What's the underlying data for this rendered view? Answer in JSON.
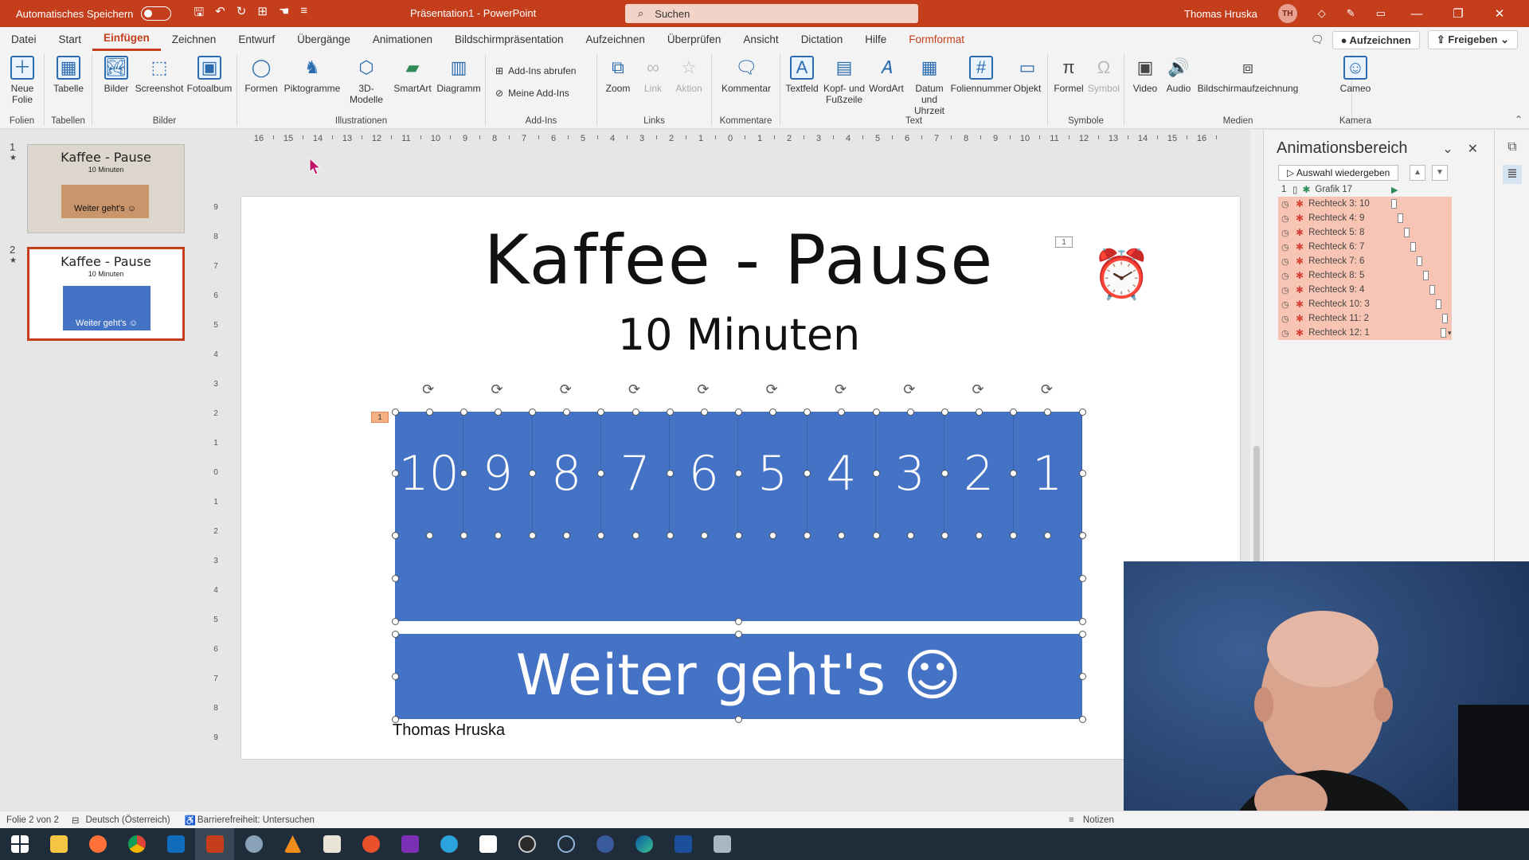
{
  "titlebar": {
    "autosave_label": "Automatisches Speichern",
    "doc_title": "Präsentation1 - PowerPoint",
    "search_placeholder": "Suchen",
    "user_name": "Thomas Hruska",
    "user_initials": "TH"
  },
  "tabs": [
    {
      "label": "Datei"
    },
    {
      "label": "Start"
    },
    {
      "label": "Einfügen"
    },
    {
      "label": "Zeichnen"
    },
    {
      "label": "Entwurf"
    },
    {
      "label": "Übergänge"
    },
    {
      "label": "Animationen"
    },
    {
      "label": "Bildschirmpräsentation"
    },
    {
      "label": "Aufzeichnen"
    },
    {
      "label": "Überprüfen"
    },
    {
      "label": "Ansicht"
    },
    {
      "label": "Dictation"
    },
    {
      "label": "Hilfe"
    },
    {
      "label": "Formformat"
    }
  ],
  "tab_actions": {
    "record": "Aufzeichnen",
    "share": "Freigeben"
  },
  "ribbon": {
    "groups": {
      "folien": "Folien",
      "tabellen": "Tabellen",
      "bilder": "Bilder",
      "illustrationen": "Illustrationen",
      "addins": "Add-Ins",
      "links": "Links",
      "kommentare": "Kommentare",
      "text": "Text",
      "symbole": "Symbole",
      "medien": "Medien",
      "kamera": "Kamera"
    },
    "buttons": {
      "neue_folie": "Neue Folie",
      "tabelle": "Tabelle",
      "bilder": "Bilder",
      "screenshot": "Screenshot",
      "fotoalbum": "Fotoalbum",
      "formen": "Formen",
      "piktogramme": "Piktogramme",
      "modelle_3d": "3D-Modelle",
      "smartart": "SmartArt",
      "diagramm": "Diagramm",
      "addins_abrufen": "Add-Ins abrufen",
      "meine_addins": "Meine Add-Ins",
      "zoom": "Zoom",
      "link": "Link",
      "aktion": "Aktion",
      "kommentar": "Kommentar",
      "textfeld": "Textfeld",
      "kopf_fuss": "Kopf- und Fußzeile",
      "wordart": "WordArt",
      "datum_uhrzeit": "Datum und Uhrzeit",
      "foliennummer": "Foliennummer",
      "objekt": "Objekt",
      "formel": "Formel",
      "symbol": "Symbol",
      "video": "Video",
      "audio": "Audio",
      "bildschirmaufzeichnung": "Bildschirmaufzeichnung",
      "cameo": "Cameo"
    }
  },
  "thumbnails": [
    {
      "num": "1",
      "title": "Kaffee - Pause",
      "sub": "10 Minuten",
      "box": "Weiter geht's ☺"
    },
    {
      "num": "2",
      "title": "Kaffee - Pause",
      "sub": "10 Minuten",
      "box": "Weiter geht's ☺"
    }
  ],
  "slide": {
    "title": "Kaffee - Pause",
    "subtitle": "10 Minuten",
    "counter": [
      "10",
      "9",
      "8",
      "7",
      "6",
      "5",
      "4",
      "3",
      "2",
      "1"
    ],
    "banner": "Weiter geht's ☺",
    "footer": "Thomas Hruska",
    "anim_tag": "1"
  },
  "anim_pane": {
    "title": "Animationsbereich",
    "play_button": "Auswahl wiedergeben",
    "items": [
      {
        "num": "1",
        "label": "Grafik 17",
        "selected": false
      },
      {
        "num": "",
        "label": "Rechteck 3: 10",
        "selected": true
      },
      {
        "num": "",
        "label": "Rechteck 4: 9",
        "selected": true
      },
      {
        "num": "",
        "label": "Rechteck 5: 8",
        "selected": true
      },
      {
        "num": "",
        "label": "Rechteck 6: 7",
        "selected": true
      },
      {
        "num": "",
        "label": "Rechteck 7: 6",
        "selected": true
      },
      {
        "num": "",
        "label": "Rechteck 8: 5",
        "selected": true
      },
      {
        "num": "",
        "label": "Rechteck 9: 4",
        "selected": true
      },
      {
        "num": "",
        "label": "Rechteck 10: 3",
        "selected": true
      },
      {
        "num": "",
        "label": "Rechteck 11: 2",
        "selected": true
      },
      {
        "num": "",
        "label": "Rechteck 12: 1",
        "selected": true
      }
    ]
  },
  "statusbar": {
    "slide_info": "Folie 2 von 2",
    "language": "Deutsch (Österreich)",
    "accessibility": "Barrierefreiheit: Untersuchen",
    "notes": "Notizen"
  },
  "colors": {
    "accent": "#c43e1c",
    "shape_fill": "#4472c4",
    "anim_selected": "#f8c5b4"
  }
}
